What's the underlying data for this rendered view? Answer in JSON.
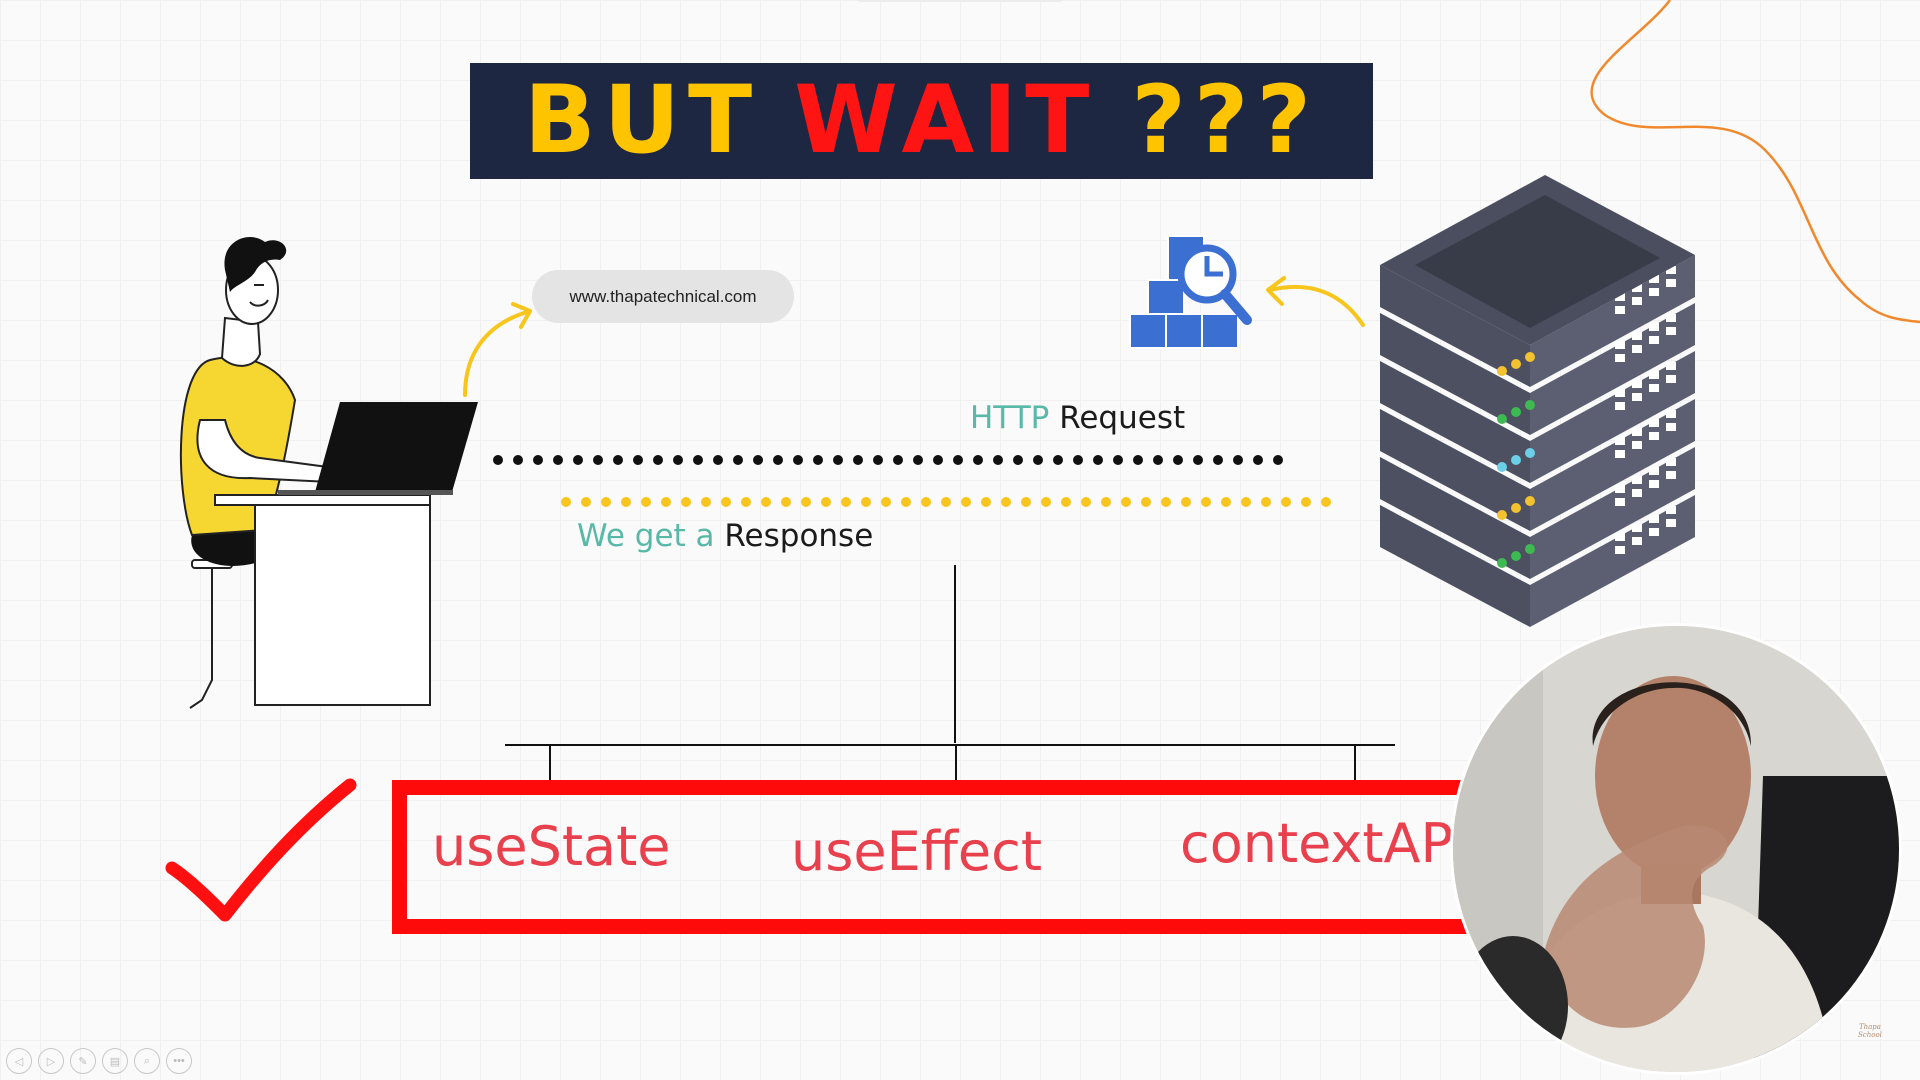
{
  "slide": {
    "title": {
      "part1": "BUT",
      "part2": "WAIT",
      "part3": "???"
    },
    "url": "www.thapatechnical.com",
    "request": {
      "protocol": "HTTP",
      "word": "Request"
    },
    "response": {
      "prefix": "We get a",
      "word": "Response"
    },
    "hooks": [
      "useState",
      "useEffect",
      "contextAPI"
    ]
  },
  "player": {
    "controls": [
      {
        "icon": "prev-icon",
        "glyph": "◁"
      },
      {
        "icon": "next-icon",
        "glyph": "▷"
      },
      {
        "icon": "pen-icon",
        "glyph": "✎"
      },
      {
        "icon": "slides-icon",
        "glyph": "▤"
      },
      {
        "icon": "zoom-icon",
        "glyph": "⌕"
      },
      {
        "icon": "more-icon",
        "glyph": "•••"
      }
    ]
  },
  "watermark": {
    "line1": "Thapa",
    "line2": "School"
  },
  "colors": {
    "banner": "#1e2741",
    "title_yellow": "#ffc400",
    "title_red": "#ff1414",
    "teal": "#58b9a8",
    "hook_red": "#e8404c",
    "box_red": "#ff0a0a",
    "check_red": "#ff1010",
    "dots_black": "#111111",
    "dots_yellow": "#f7c51b",
    "curve_orange": "#f0892e",
    "server": "#525667"
  }
}
